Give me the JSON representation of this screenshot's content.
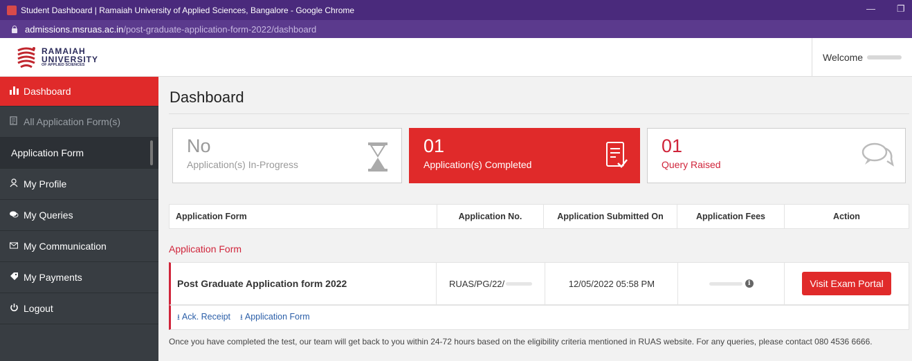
{
  "browser": {
    "window_title": "Student Dashboard | Ramaiah University of Applied Sciences, Bangalore - Google Chrome",
    "url_host": "admissions.msruas.ac.in",
    "url_path": "/post-graduate-application-form-2022/dashboard",
    "minimize_glyph": "—",
    "restore_glyph": "❐"
  },
  "header": {
    "logo_line1": "RAMAIAH",
    "logo_line2": "UNIVERSITY",
    "logo_line3": "OF APPLIED SCIENCES",
    "welcome_label": "Welcome"
  },
  "sidebar": {
    "items": [
      {
        "label": "Dashboard",
        "icon": "bar-chart-icon"
      },
      {
        "label": "All Application Form(s)",
        "icon": "document-icon"
      },
      {
        "label": "Application Form"
      },
      {
        "label": "My Profile",
        "icon": "user-icon"
      },
      {
        "label": "My Queries",
        "icon": "chat-icon"
      },
      {
        "label": "My Communication",
        "icon": "envelope-icon"
      },
      {
        "label": "My Payments",
        "icon": "tag-icon"
      },
      {
        "label": "Logout",
        "icon": "power-icon"
      }
    ]
  },
  "main": {
    "title": "Dashboard",
    "cards": [
      {
        "big": "No",
        "sub": "Application(s) In-Progress",
        "icon": "hourglass-icon"
      },
      {
        "big": "01",
        "sub": "Application(s) Completed",
        "icon": "checklist-icon"
      },
      {
        "big": "01",
        "sub": "Query Raised",
        "icon": "chat-bubbles-icon"
      }
    ],
    "table": {
      "headers": [
        "Application Form",
        "Application No.",
        "Application Submitted On",
        "Application Fees",
        "Action"
      ],
      "section_label": "Application Form",
      "row": {
        "form_name": "Post Graduate Application form 2022",
        "application_no": "RUAS/PG/22/",
        "submitted_on": "12/05/2022 05:58 PM",
        "action_label": "Visit Exam Portal"
      },
      "links": [
        {
          "label": "Ack. Receipt"
        },
        {
          "label": "Application Form"
        }
      ]
    },
    "note": "Once you have completed the test, our team will get back to you within 24-72 hours based on the eligibility criteria mentioned in RUAS website. For any queries, please contact 080 4536 6666."
  },
  "colors": {
    "accent_red": "#e02a2a",
    "titlebar_purple": "#4a2a7c",
    "sidebar_dark": "#383d42",
    "link_blue": "#2a5ea8"
  }
}
